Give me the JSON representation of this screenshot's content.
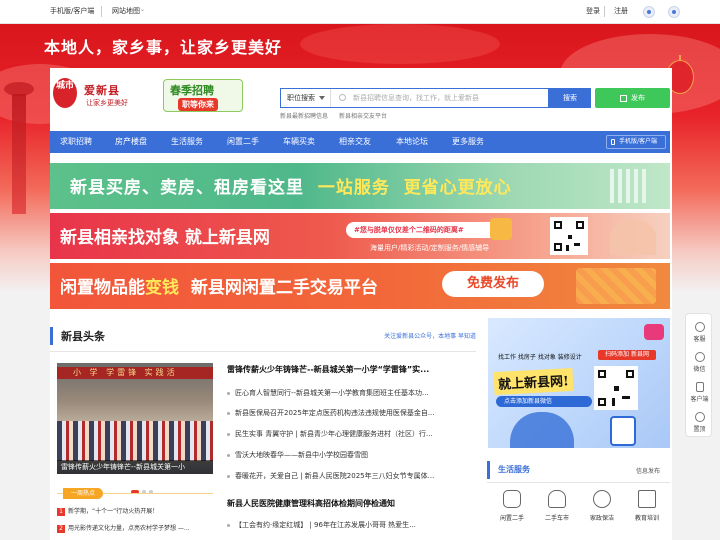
{
  "topbar": {
    "mobile": "手机版/客户端",
    "sitemap": "网站地图",
    "login": "登录",
    "register": "注册"
  },
  "hero": {
    "slogan": "本地人，家乡事，让家乡更美好"
  },
  "logo": {
    "badge": "城市",
    "name": "爱新县",
    "sub": "让家乡更美好"
  },
  "spring": {
    "title": "春季招聘",
    "tag": "职等你来"
  },
  "search": {
    "category": "职位搜索",
    "placeholder": "新县招聘信息查询，找工作，就上爱新县",
    "button": "搜索",
    "publish": "发布",
    "hint1": "新县最新招聘信息",
    "hint2": "新县相亲交友平台"
  },
  "nav": {
    "items": [
      "求职招聘",
      "房产楼盘",
      "生活服务",
      "闲置二手",
      "车辆买卖",
      "相亲交友",
      "本地论坛",
      "更多服务"
    ],
    "mobile": "手机版/客户端"
  },
  "banners": {
    "b1_part1": "新县买房、卖房、租房看这里",
    "b1_part2": "一站服务",
    "b1_part3": "更省心更放心",
    "b2_title": "新县相亲找对象 就上新县网",
    "b2_pill": "#您与脱单仅仅差个二维码的距离#",
    "b2_sub": "海量用户/精彩活动/定制服务/情感辅导",
    "b3_part1": "闲置物品能",
    "b3_part2": "变钱",
    "b3_part3": "新县网闲置二手交易平台",
    "b3_free": "免费发布"
  },
  "headlines": {
    "title": "新县头条",
    "follow": "关注爱新县公众号，本地事 早知道",
    "photo_banner": "小 学 学雷锋 实践活",
    "photo_caption": "雷锋传薪火少年铸锋芒--新县城关第一小",
    "hot_badge": "一周热点",
    "hot": [
      {
        "n": "1",
        "text": "新学期，“十个一”行动火热开展！"
      },
      {
        "n": "2",
        "text": "用光影传递文化力量，点亮农村学子梦想 —..."
      }
    ],
    "news": [
      {
        "text": "雷锋传薪火少年铸锋芒--新县城关第一小学“学雷锋”实...",
        "bold": true
      },
      {
        "text": "匠心育人智慧同行--新县城关第一小学教育集团班主任基本功...",
        "bold": false
      },
      {
        "text": "新县医保局召开2025年定点医药机构违法违规使用医保基金自...",
        "bold": false
      },
      {
        "text": "民生实事 青翼守护 | 新县青少年心理健康服务进村（社区）行...",
        "bold": false
      },
      {
        "text": "雪沃大地映春华——新县中小学校园春雪图",
        "bold": false
      },
      {
        "text": "春暖花开，关爱自己 | 新县人民医院2025年三八妇女节专属体...",
        "bold": false
      },
      {
        "text": "新县人民医院健康管理科高招体检期间停检通知",
        "bold": true
      },
      {
        "text": "【工会有约·缘定红城】 | 96年在江苏发展小哥哥 热爱生...",
        "bold": false
      }
    ]
  },
  "ad": {
    "top": "找工作 找房子 找对象 装修设计",
    "badge": "扫码添加 新县网",
    "big": "就上新县网!",
    "blue": "点击添加新县微信"
  },
  "life": {
    "title": "生活服务",
    "more": "信息发布",
    "items": [
      "闲置二手",
      "二手车市",
      "家政保洁",
      "教育培训"
    ]
  },
  "float": {
    "items": [
      "客服",
      "微信",
      "客户端",
      "置顶"
    ]
  },
  "colors": {
    "brand_red": "#d8232a",
    "primary_blue": "#3a6fd8",
    "publish_green": "#3fc85a"
  }
}
